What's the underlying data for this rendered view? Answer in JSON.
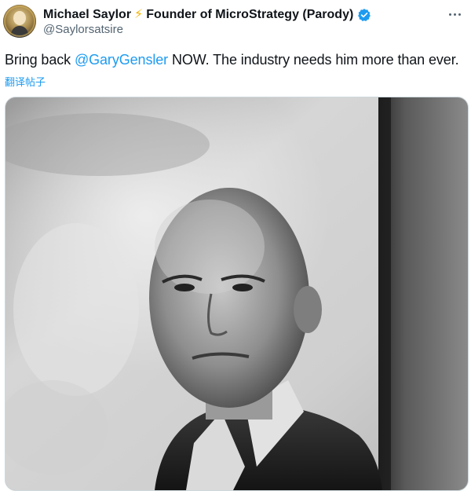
{
  "tweet": {
    "author": {
      "display_name": "Michael Saylor",
      "bolt": "⚡",
      "title": "Founder of MicroStrategy (Parody)",
      "handle": "@Saylorsatsire",
      "verified_color": "#1d9bf0",
      "avatar_icon": "profile-photo"
    },
    "text": {
      "before": "Bring back ",
      "mention": "@GaryGensler",
      "after": " NOW. The industry needs him more than ever."
    },
    "translate_label": "翻译帖子",
    "more_icon": "more-dots-icon",
    "media": {
      "kind": "black-and-white portrait photo"
    }
  },
  "colors": {
    "link": "#1d9bf0",
    "text": "#0f1419",
    "secondary": "#536471",
    "bolt": "#f6b400"
  }
}
